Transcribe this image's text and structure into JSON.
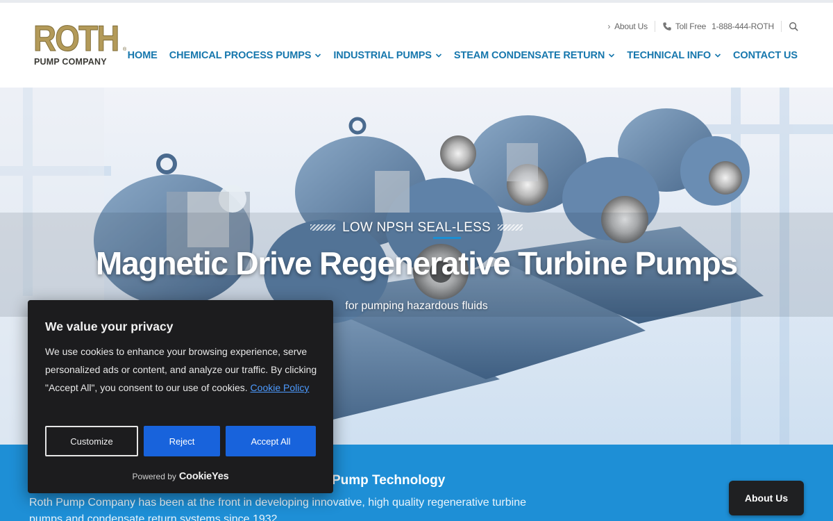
{
  "brand": {
    "logo_main": "ROTH",
    "logo_registered": "®",
    "logo_sub": "PUMP COMPANY"
  },
  "utility": {
    "about_label": "About Us",
    "toll_free_label": "Toll Free",
    "phone": "1-888-444-ROTH"
  },
  "nav": {
    "items": [
      {
        "label": "HOME",
        "dropdown": false
      },
      {
        "label": "CHEMICAL PROCESS PUMPS",
        "dropdown": true
      },
      {
        "label": "INDUSTRIAL PUMPS",
        "dropdown": true
      },
      {
        "label": "STEAM CONDENSATE RETURN",
        "dropdown": true
      },
      {
        "label": "TECHNICAL INFO",
        "dropdown": true
      },
      {
        "label": "CONTACT US",
        "dropdown": false
      }
    ]
  },
  "hero": {
    "eyebrow": "LOW NPSH SEAL-LESS",
    "title": "Magnetic Drive Regenerative Turbine Pumps",
    "subtitle": "for pumping hazardous fluids"
  },
  "band": {
    "title": "Pump Technology",
    "text": "Roth Pump Company has been at the front in developing innovative, high quality regenerative turbine pumps and condensate return systems since 1932"
  },
  "floating_button": {
    "label": "About Us"
  },
  "cookie_banner": {
    "title": "We value your privacy",
    "body": "We use cookies to enhance your browsing experience, serve personalized ads or content, and analyze our traffic. By clicking \"Accept All\", you consent to our use of cookies.",
    "policy_link": "Cookie Policy",
    "customize_label": "Customize",
    "reject_label": "Reject",
    "accept_label": "Accept All",
    "powered_by": "Powered by",
    "powered_brand": "CookieYes"
  },
  "colors": {
    "nav_blue": "#1677ad",
    "band_blue": "#1e8fd6",
    "logo_gold": "#b39a59",
    "cookie_bg": "#1c1c1e",
    "cookie_button_blue": "#1863dc"
  }
}
